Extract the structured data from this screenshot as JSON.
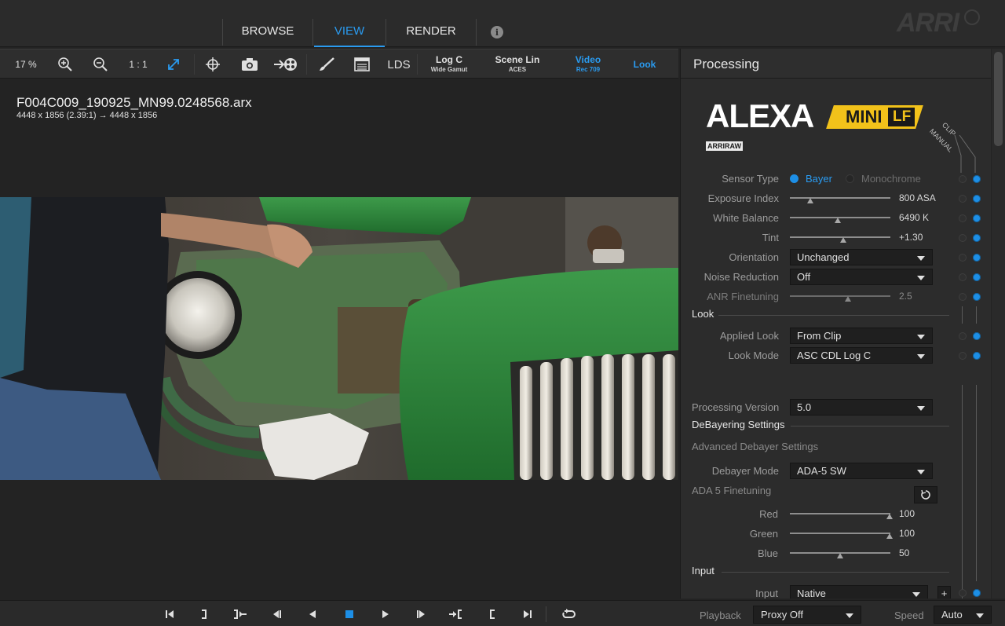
{
  "top_tabs": [
    {
      "label": "BROWSE",
      "active": false
    },
    {
      "label": "VIEW",
      "active": true
    },
    {
      "label": "RENDER",
      "active": false
    }
  ],
  "info_icon": "i",
  "brand": "ARRI",
  "toolbar": {
    "zoom": "17 %",
    "one_to_one": "1 : 1",
    "lds": "LDS",
    "color_spaces": [
      {
        "line1": "Log C",
        "line2": "Wide Gamut",
        "active": false
      },
      {
        "line1": "Scene Lin",
        "line2": "ACES",
        "active": false
      },
      {
        "line1": "Video",
        "line2": "Rec 709",
        "active": true
      },
      {
        "line1": "Look",
        "line2": "",
        "active": true
      }
    ],
    "icons": [
      "zoom-in-icon",
      "zoom-out-icon",
      "fit-icon",
      "crosshair-icon",
      "camera-icon",
      "export-icon",
      "brush-icon",
      "overlay-icon"
    ]
  },
  "viewer": {
    "file_name": "F004C009_190925_MN99.0248568.arx",
    "dimensions": "4448 x 1856 (2.39:1) → 4448 x 1856"
  },
  "panel": {
    "title": "Processing",
    "camera_logo": "ALEXA",
    "camera_model_1": "MINI",
    "camera_model_2": "LF",
    "format_badge": "ARRIRAW",
    "col_clip": "CLIP",
    "col_manual": "MANUAL",
    "sensor_type": {
      "label": "Sensor Type",
      "option_on": "Bayer",
      "option_off": "Monochrome"
    },
    "exposure_index": {
      "label": "Exposure Index",
      "value": "800 ASA",
      "pos": 0.2
    },
    "white_balance": {
      "label": "White Balance",
      "value": "6490 K",
      "pos": 0.48
    },
    "tint": {
      "label": "Tint",
      "value": "+1.30",
      "pos": 0.53
    },
    "orientation": {
      "label": "Orientation",
      "value": "Unchanged"
    },
    "noise_reduction": {
      "label": "Noise Reduction",
      "value": "Off"
    },
    "anr_finetuning": {
      "label": "ANR Finetuning",
      "value": "2.5",
      "pos": 0.58
    },
    "look_section": "Look",
    "applied_look": {
      "label": "Applied Look",
      "value": "From Clip"
    },
    "look_mode": {
      "label": "Look Mode",
      "value": "ASC CDL Log C"
    },
    "processing_version": {
      "label": "Processing Version",
      "value": "5.0"
    },
    "debayer_section": "DeBayering Settings",
    "advanced_debayer": "Advanced Debayer Settings",
    "debayer_mode": {
      "label": "Debayer Mode",
      "value": "ADA-5 SW"
    },
    "ada5_finetuning": "ADA 5 Finetuning",
    "red": {
      "label": "Red",
      "value": "100",
      "pos": 0.99
    },
    "green": {
      "label": "Green",
      "value": "100",
      "pos": 0.99
    },
    "blue": {
      "label": "Blue",
      "value": "50",
      "pos": 0.5
    },
    "input_section": "Input",
    "input": {
      "label": "Input",
      "value": "Native"
    },
    "plus": "+"
  },
  "bottom": {
    "playback_label": "Playback",
    "playback_value": "Proxy Off",
    "speed_label": "Speed",
    "speed_value": "Auto"
  },
  "colors": {
    "accent": "#2a9bf0",
    "tractor_green": "#2f8a3c",
    "badge_yellow": "#f2c21a"
  }
}
